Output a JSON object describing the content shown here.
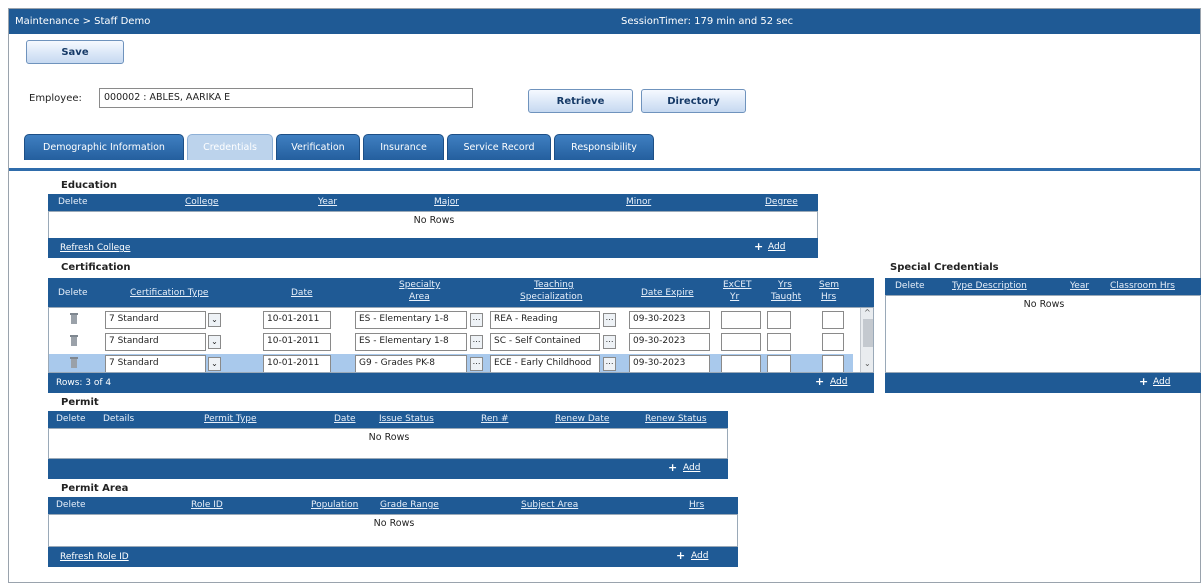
{
  "titlebar": {
    "breadcrumb": "Maintenance > Staff Demo",
    "session_timer": "SessionTimer: 179 min and 52 sec"
  },
  "toolbar": {
    "save_label": "Save"
  },
  "employee": {
    "label": "Employee:",
    "value": "000002 : ABLES, AARIKA E",
    "retrieve_label": "Retrieve",
    "directory_label": "Directory"
  },
  "tabs": [
    {
      "label": "Demographic Information"
    },
    {
      "label": "Credentials"
    },
    {
      "label": "Verification"
    },
    {
      "label": "Insurance"
    },
    {
      "label": "Service Record"
    },
    {
      "label": "Responsibility"
    }
  ],
  "education": {
    "title": "Education",
    "columns": [
      "Delete",
      "College",
      "Year",
      "Major",
      "Minor",
      "Degree"
    ],
    "no_rows": "No Rows",
    "refresh_label": "Refresh College",
    "add_label": "Add"
  },
  "certification": {
    "title": "Certification",
    "columns": [
      "Delete",
      "Certification Type",
      "Date",
      "Specialty",
      "Area",
      "Teaching",
      "Specialization",
      "Date Expire",
      "ExCET",
      "Yr",
      "Yrs",
      "Taught",
      "Sem",
      "Hrs"
    ],
    "rows": [
      {
        "type": "7 Standard",
        "date": "10-01-2011",
        "specialty": "ES - Elementary 1-8",
        "teaching": "REA - Reading",
        "expire": "09-30-2023"
      },
      {
        "type": "7 Standard",
        "date": "10-01-2011",
        "specialty": "ES - Elementary 1-8",
        "teaching": "SC - Self Contained",
        "expire": "09-30-2023"
      },
      {
        "type": "7 Standard",
        "date": "10-01-2011",
        "specialty": "G9 - Grades PK-8",
        "teaching": "ECE - Early Childhood",
        "expire": "09-30-2023"
      }
    ],
    "row_count": "Rows: 3 of 4",
    "add_label": "Add"
  },
  "special_credentials": {
    "title": "Special Credentials",
    "columns": [
      "Delete",
      "Type Description",
      "Year",
      "Classroom Hrs"
    ],
    "no_rows": "No Rows",
    "add_label": "Add"
  },
  "permit": {
    "title": "Permit",
    "columns": [
      "Delete",
      "Details",
      "Permit Type",
      "Date",
      "Issue Status",
      "Ren #",
      "Renew Date",
      "Renew Status"
    ],
    "no_rows": "No Rows",
    "add_label": "Add"
  },
  "permit_area": {
    "title": "Permit Area",
    "columns": [
      "Delete",
      "Role ID",
      "Population",
      "Grade Range",
      "Subject Area",
      "Hrs"
    ],
    "no_rows": "No Rows",
    "refresh_label": "Refresh Role ID",
    "add_label": "Add"
  },
  "colors": {
    "header_blue": "#1f5a95",
    "selected_row": "#a9c9ec"
  },
  "icons": {
    "delete": "trash-icon",
    "lookup": "ellipsis-icon",
    "dropdown": "chevron-down-icon",
    "add": "plus-icon"
  }
}
